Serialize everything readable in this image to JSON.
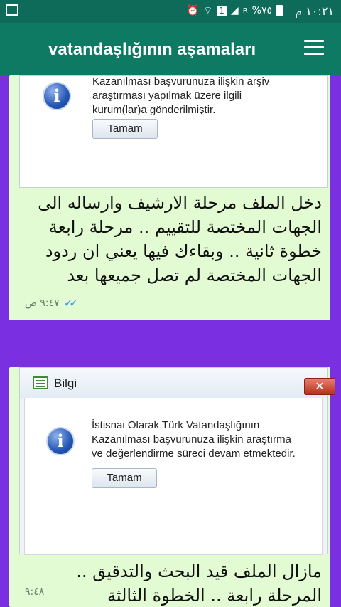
{
  "status_bar": {
    "time": "١٠:٢١ م",
    "battery": "%٧٥",
    "sim_badge": "1",
    "roaming": "R"
  },
  "app_bar": {
    "title": "vatandaşlığının aşamaları"
  },
  "messages": [
    {
      "dialog": {
        "text_lines": [
          "Kazanılması başvurunuza ilişkin arşiv",
          "araştırması yapılmak üzere ilgili",
          "kurum(lar)a gönderilmiştir."
        ],
        "button": "Tamam"
      },
      "text_lines": [
        "دخل الملف مرحلة الارشيف وارساله الى",
        "الجهات المختصة للتقييم  .. مرحلة رابعة",
        "خطوة ثانية ..  وبقاءك فيها يعني ان ردود",
        "الجهات المختصة لم تصل جميعها بعد"
      ],
      "time": "٩:٤٧ ص"
    },
    {
      "dialog": {
        "title": "Bilgi",
        "close": "✕",
        "text_lines": [
          "İstisnai Olarak Türk Vatandaşlığının",
          "Kazanılması başvurunuza ilişkin araştırma",
          "ve değerlendirme süreci devam etmektedir."
        ],
        "button": "Tamam"
      },
      "text_lines": [
        "مازال الملف قيد البحث والتدقيق ..",
        "المرحلة رابعة .. الخطوة الثالثة"
      ],
      "time": "٩:٤٨"
    }
  ],
  "colors": {
    "status_bar": "#0e6b5a",
    "app_bar": "#0f7a63",
    "chat_background": "#7a2fe0",
    "bubble": "#e2fbd2",
    "read_ticks": "#3b9ae8"
  }
}
